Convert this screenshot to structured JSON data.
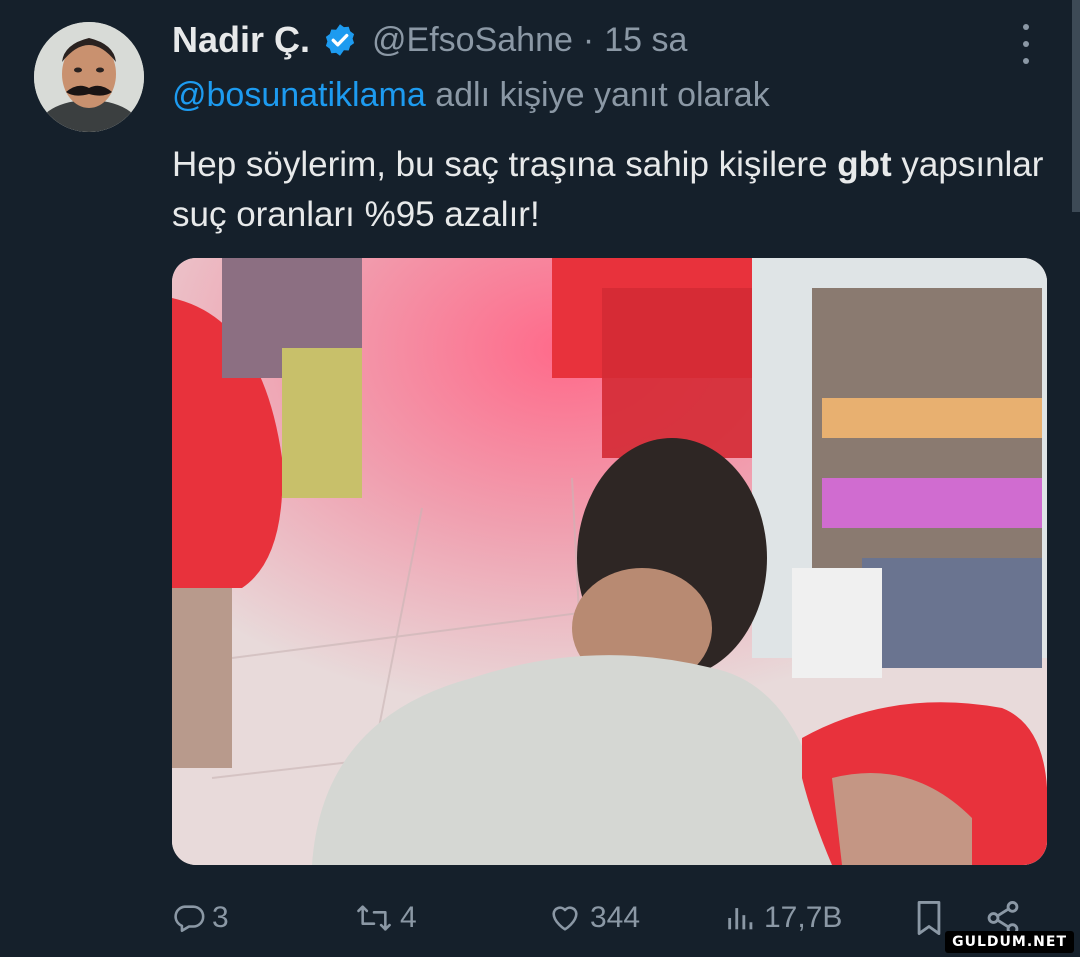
{
  "tweet": {
    "author_name": "Nadir Ç.",
    "handle": "@EfsoSahne",
    "separator": "·",
    "time": "15 sa",
    "reply_mention": "@bosunatiklama",
    "reply_suffix": " adlı kişiye yanıt olarak",
    "text_part1": "Hep söylerim, bu saç traşına sahip kişilere ",
    "text_bold": "gbt",
    "text_part2": " yapsınlar suç oranları %95 azalır!"
  },
  "actions": {
    "replies": "3",
    "retweets": "4",
    "likes": "344",
    "views": "17,7B"
  },
  "icons": {
    "verified": "verified-badge-icon",
    "more": "more-vertical-icon",
    "reply": "comment-icon",
    "retweet": "retweet-icon",
    "like": "heart-icon",
    "views": "bar-chart-icon",
    "bookmark": "bookmark-icon",
    "share": "share-icon"
  },
  "colors": {
    "background": "#15202b",
    "text": "#e7e9ea",
    "muted": "#8b98a5",
    "accent": "#1d9bf0"
  },
  "watermark": "GULDUM.NET"
}
